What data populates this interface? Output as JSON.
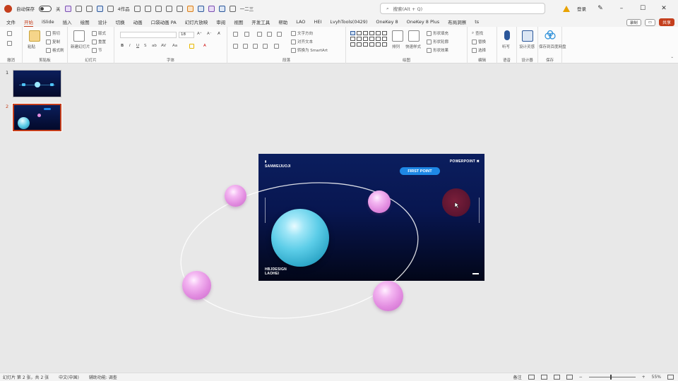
{
  "titlebar": {
    "autosave_label": "自动保存",
    "toggle_state": "关",
    "file_name": "4作品",
    "mode_label": "一二三",
    "search_placeholder": "搜索(Alt + Q)",
    "user_label": "登录"
  },
  "menu": {
    "tabs": [
      "文件",
      "开始",
      "iSlide",
      "插入",
      "绘图",
      "设计",
      "切换",
      "动画",
      "口袋动画 PA",
      "幻灯片放映",
      "审阅",
      "视图",
      "开发工具",
      "帮助",
      "LAO",
      "HEI",
      "LvyhTools(0429)",
      "OneKey 8",
      "OneKey 8 Plus",
      "布局洞察",
      "ts"
    ],
    "active_index": 1,
    "record_label": "录制",
    "share_label": "共享"
  },
  "ribbon": {
    "groups": [
      {
        "label": "撤消"
      },
      {
        "label": "剪贴板",
        "buttons": [
          "粘贴",
          "剪切",
          "复制",
          "格式刷"
        ]
      },
      {
        "label": "幻灯片",
        "buttons": [
          "新建幻灯片",
          "版式",
          "重置",
          "节"
        ]
      },
      {
        "label": "字体",
        "font_size": "18"
      },
      {
        "label": "段落",
        "buttons": [
          "文字方向",
          "对齐文本",
          "转换为 SmartArt"
        ]
      },
      {
        "label": "绘图",
        "buttons": [
          "排列",
          "快速样式",
          "形状填充",
          "形状轮廓",
          "形状效果"
        ]
      },
      {
        "label": "编辑",
        "buttons": [
          "查找",
          "替换",
          "选择"
        ]
      },
      {
        "label": "语音",
        "buttons": [
          "听写"
        ]
      },
      {
        "label": "设计器",
        "buttons": [
          "设计灵感"
        ]
      },
      {
        "label": "保存",
        "buttons": [
          "保存到百度网盘"
        ]
      }
    ]
  },
  "thumbnails": {
    "items": [
      {
        "number": "1"
      },
      {
        "number": "2"
      }
    ],
    "active_index": 1
  },
  "slide": {
    "brand_line1": "SANWEIJUOJI",
    "powerpoint_label": "POWERPOINT ✖",
    "pill_label": "FIRST POINT",
    "bottom_line1": "HBJDESIGN",
    "bottom_line2": "LAOHEI"
  },
  "statusbar": {
    "slide_info": "幻灯片 第 2 张，共 2 张",
    "language": "中文(中国)",
    "accessibility": "辅助功能: 调查",
    "notes_label": "备注",
    "zoom": "55%"
  },
  "colors": {
    "accent": "#c43e1c",
    "slide_top": "#0b1e5e",
    "slide_bottom": "#020618",
    "pill": "#1e88e5",
    "sphere_blue": "#5ccde8",
    "sphere_pink": "#e28ce0"
  }
}
